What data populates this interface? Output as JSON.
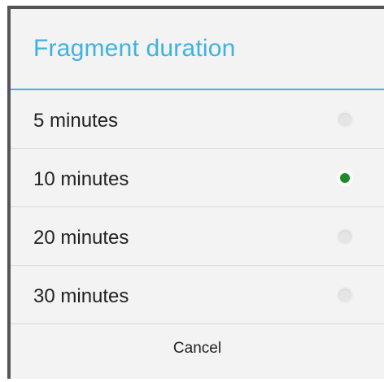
{
  "dialog": {
    "title": "Fragment duration",
    "accent_color": "#3fb2e0",
    "selected_color": "#1e8b2a",
    "options": [
      {
        "label": "5 minutes",
        "selected": false
      },
      {
        "label": "10 minutes",
        "selected": true
      },
      {
        "label": "20 minutes",
        "selected": false
      },
      {
        "label": "30 minutes",
        "selected": false
      }
    ],
    "cancel_label": "Cancel"
  }
}
